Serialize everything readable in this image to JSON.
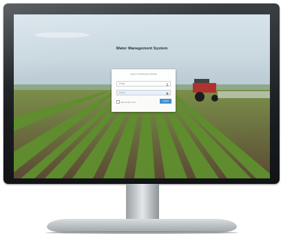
{
  "app": {
    "title": "Water Management System"
  },
  "login": {
    "prompt": "Log in to start your session",
    "username_placeholder": "Email",
    "password_value": "••••••••",
    "remember_label": "Remember me?",
    "submit_label": "Log in"
  },
  "icons": {
    "username": "user-icon",
    "password": "lock-icon",
    "remember": "checkbox-icon"
  },
  "colors": {
    "accent": "#3d8fd6",
    "frame": "#1b1e21",
    "sky": "#c5d6df",
    "crop": "#5f8f2e"
  }
}
